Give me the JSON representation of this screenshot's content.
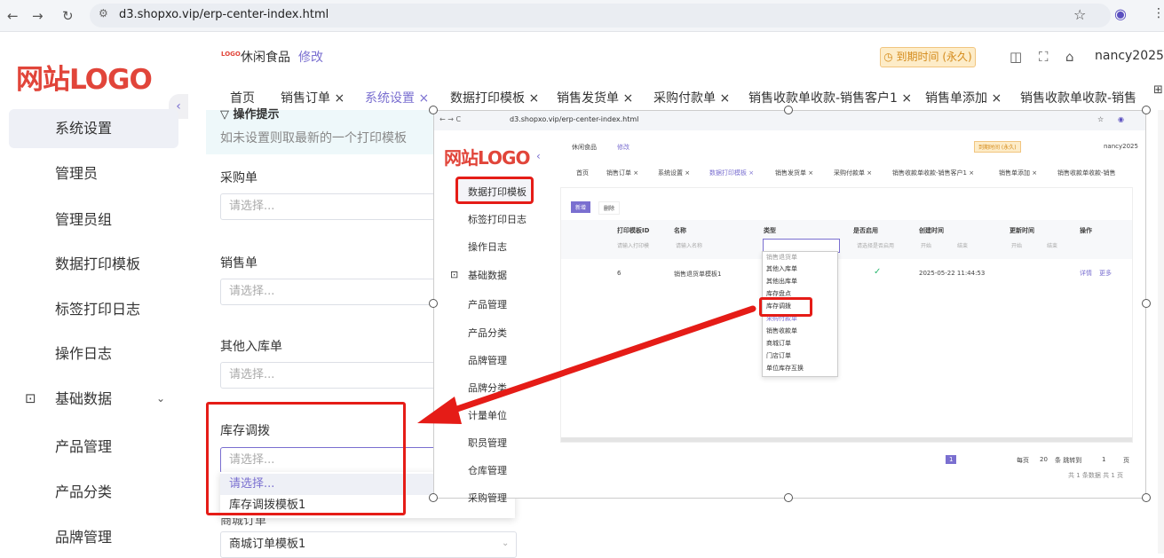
{
  "browser": {
    "url": "d3.shopxo.vip/erp-center-index.html"
  },
  "sidebar": {
    "logo": "网站LOGO",
    "items": [
      {
        "label": "系统设置",
        "active": true
      },
      {
        "label": "管理员"
      },
      {
        "label": "管理员组"
      },
      {
        "label": "数据打印模板"
      },
      {
        "label": "标签打印日志"
      },
      {
        "label": "操作日志"
      },
      {
        "label": "基础数据"
      },
      {
        "label": "产品管理"
      },
      {
        "label": "产品分类"
      },
      {
        "label": "品牌管理"
      }
    ]
  },
  "header": {
    "logo_small": "LOGO",
    "title": "休闲食品",
    "edit": "修改",
    "expire": "到期时间 (永久)",
    "user": "nancy2025"
  },
  "tabs": [
    "首页",
    "销售订单 ×",
    "系统设置 ×",
    "数据打印模板 ×",
    "销售发货单 ×",
    "采购付款单 ×",
    "销售收款单收款-销售客户1 ×",
    "销售单添加 ×",
    "销售收款单收款-销售"
  ],
  "main": {
    "tip_title": "操作提示",
    "tip_text": "如未设置则取最新的一个打印模板",
    "fields": [
      {
        "label": "采购单",
        "placeholder": "请选择..."
      },
      {
        "label": "销售单",
        "placeholder": "请选择..."
      },
      {
        "label": "其他入库单",
        "placeholder": "请选择..."
      },
      {
        "label": "库存调拨",
        "placeholder": "请选择..."
      }
    ],
    "dropdown": [
      "请选择...",
      "库存调拨模板1"
    ],
    "next_label": "商城订单",
    "next_value": "商城订单模板1"
  },
  "embedded": {
    "url": "d3.shopxo.vip/erp-center-index.html",
    "logo": "网站LOGO",
    "title": "休闲食品",
    "edit": "修改",
    "expire": "到期时间 (永久)",
    "user": "nancy2025",
    "tabs": [
      "首页",
      "销售订单 ×",
      "系统设置 ×",
      "数据打印模板 ×",
      "销售发货单 ×",
      "采购付款单 ×",
      "销售收款单收款-销售客户1 ×",
      "销售单添加 ×",
      "销售收款单收款-销售"
    ],
    "menu": [
      "数据打印模板",
      "标签打印日志",
      "操作日志",
      "基础数据",
      "产品管理",
      "产品分类",
      "品牌管理",
      "品牌分类",
      "计量单位",
      "职员管理",
      "仓库管理",
      "采购管理"
    ],
    "btn_add": "新增",
    "btn_del": "删除",
    "columns": [
      "打印模板ID",
      "名称",
      "类型",
      "是否启用",
      "创建时间",
      "更新时间",
      "操作"
    ],
    "filters": [
      "请输入打印模",
      "请输入名称",
      "",
      "请选择是否启用",
      "开始",
      "结束",
      "开始",
      "结束"
    ],
    "row": {
      "id": "6",
      "name": "销售退货单模板1",
      "created": "2025-05-22 11:44:53",
      "detail": "详情",
      "more": "更多"
    },
    "type_options": [
      "销售退货单",
      "其他入库单",
      "其他出库单",
      "库存盘点",
      "库存调拨",
      "采购付款单",
      "销售收款单",
      "商城订单",
      "门店订单",
      "单位库存互换"
    ],
    "pager": {
      "per_page_label": "每页",
      "per_page": "20",
      "unit": "条 跳转到",
      "goto": "1",
      "page_word": "页",
      "total": "共 1 条数据 共 1 页",
      "current": "1"
    }
  }
}
